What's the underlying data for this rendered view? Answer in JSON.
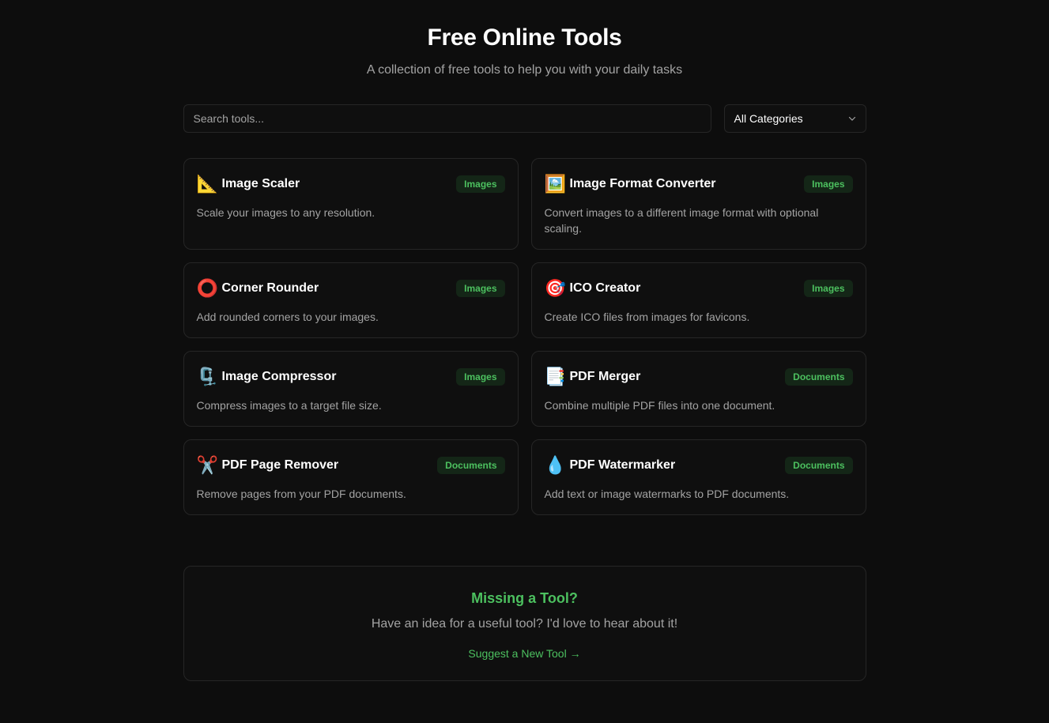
{
  "header": {
    "title": "Free Online Tools",
    "subtitle": "A collection of free tools to help you with your daily tasks"
  },
  "search": {
    "placeholder": "Search tools...",
    "value": ""
  },
  "category_select": {
    "selected": "All Categories"
  },
  "colors": {
    "accent": "#4cc05f",
    "badge_bg": "#142617",
    "background": "#0d0d0d",
    "border": "#262626"
  },
  "tools": [
    {
      "icon": "📐",
      "icon_name": "triangular-ruler-icon",
      "title": "Image Scaler",
      "category": "Images",
      "description": "Scale your images to any resolution."
    },
    {
      "icon": "🖼️",
      "icon_name": "framed-picture-icon",
      "title": "Image Format Converter",
      "category": "Images",
      "description": "Convert images to a different image format with optional scaling."
    },
    {
      "icon": "⭕",
      "icon_name": "hollow-circle-icon",
      "title": "Corner Rounder",
      "category": "Images",
      "description": "Add rounded corners to your images."
    },
    {
      "icon": "🎯",
      "icon_name": "target-icon",
      "title": "ICO Creator",
      "category": "Images",
      "description": "Create ICO files from images for favicons."
    },
    {
      "icon": "🗜️",
      "icon_name": "clamp-icon",
      "title": "Image Compressor",
      "category": "Images",
      "description": "Compress images to a target file size."
    },
    {
      "icon": "📑",
      "icon_name": "bookmark-tabs-icon",
      "title": "PDF Merger",
      "category": "Documents",
      "description": "Combine multiple PDF files into one document."
    },
    {
      "icon": "✂️",
      "icon_name": "scissors-icon",
      "title": "PDF Page Remover",
      "category": "Documents",
      "description": "Remove pages from your PDF documents."
    },
    {
      "icon": "💧",
      "icon_name": "droplet-icon",
      "title": "PDF Watermarker",
      "category": "Documents",
      "description": "Add text or image watermarks to PDF documents."
    }
  ],
  "suggest": {
    "title": "Missing a Tool?",
    "text": "Have an idea for a useful tool? I'd love to hear about it!",
    "link": "Suggest a New Tool →"
  }
}
